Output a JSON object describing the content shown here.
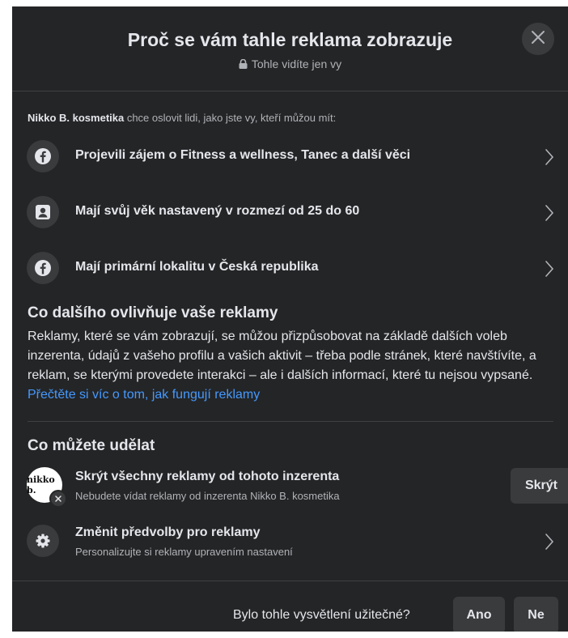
{
  "dialog": {
    "title": "Proč se vám tahle reklama zobrazuje",
    "subtitle": "Tohle vidíte jen vy"
  },
  "intro": {
    "advertiser": "Nikko B. kosmetika",
    "text": " chce oslovit lidi, jako jste vy, kteří můžou mít:"
  },
  "reasons": [
    {
      "icon": "facebook-icon",
      "label": "Projevili zájem o Fitness a wellness, Tanec a další věci"
    },
    {
      "icon": "profile-card-icon",
      "label": "Mají svůj věk nastavený v rozmezí od 25 do 60"
    },
    {
      "icon": "facebook-icon",
      "label": "Mají primární lokalitu v Česká republika"
    }
  ],
  "other_factors": {
    "title": "Co dalšího ovlivňuje vaše reklamy",
    "body": "Reklamy, které se vám zobrazují, se můžou přizpůsobovat na základě dalších voleb inzerenta, údajů z vašeho profilu a vašich aktivit – třeba podle stránek, které navštívíte, a reklam, se kterými provedete interakci – ale i dalších informací, které tu nejsou vypsané. ",
    "link": "Přečtěte si víc o tom, jak fungují reklamy"
  },
  "actions": {
    "title": "Co můžete udělat",
    "hide": {
      "avatar_text": "nikko b.",
      "title": "Skrýt všechny reklamy od tohoto inzerenta",
      "subtitle": "Nebudete vídat reklamy od inzerenta Nikko B. kosmetika",
      "button": "Skrýt"
    },
    "prefs": {
      "icon": "gear-icon",
      "title": "Změnit předvolby pro reklamy",
      "subtitle": "Personalizujte si reklamy upravením nastavení"
    }
  },
  "footer": {
    "question": "Bylo tohle vysvětlení užitečné?",
    "yes": "Ano",
    "no": "Ne"
  }
}
